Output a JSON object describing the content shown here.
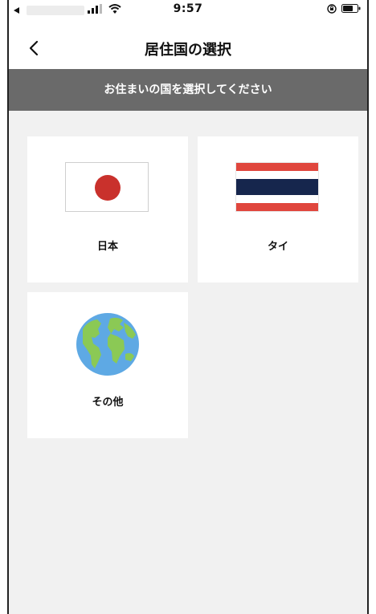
{
  "status_bar": {
    "time": "9:57"
  },
  "nav": {
    "title": "居住国の選択",
    "back_icon": "chevron-left-icon"
  },
  "banner": {
    "text": "お住まいの国を選択してください"
  },
  "countries": [
    {
      "label": "日本",
      "icon": "japan-flag-icon"
    },
    {
      "label": "タイ",
      "icon": "thailand-flag-icon"
    },
    {
      "label": "その他",
      "icon": "globe-icon"
    }
  ],
  "colors": {
    "background": "#f1f1f1",
    "banner": "#6a6a6a",
    "japan_red": "#c9312c",
    "thai_red": "#e0463d",
    "thai_blue": "#16264d",
    "globe_ocean": "#5ea9e4",
    "globe_land": "#8bc955"
  }
}
